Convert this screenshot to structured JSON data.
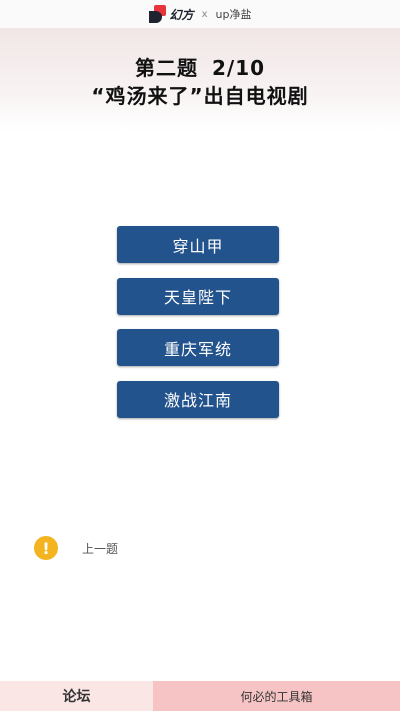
{
  "brand": {
    "logo_text": "幻方",
    "separator": "x",
    "partner": "up净盐"
  },
  "question": {
    "number_label": "第二题",
    "progress": "2/10",
    "prompt": "“鸡汤来了”出自电视剧"
  },
  "options": [
    "穿山甲",
    "天皇陛下",
    "重庆军统",
    "激战江南"
  ],
  "previous": {
    "icon": "exclamation-icon",
    "label": "上一题"
  },
  "bottom_bar": {
    "left_label": "论坛",
    "right_label": "何必的工具箱"
  },
  "colors": {
    "option_bg": "#23538d",
    "warning": "#f3b420",
    "bottom_left": "#fbe6e6",
    "bottom_right": "#f6c4c4"
  }
}
